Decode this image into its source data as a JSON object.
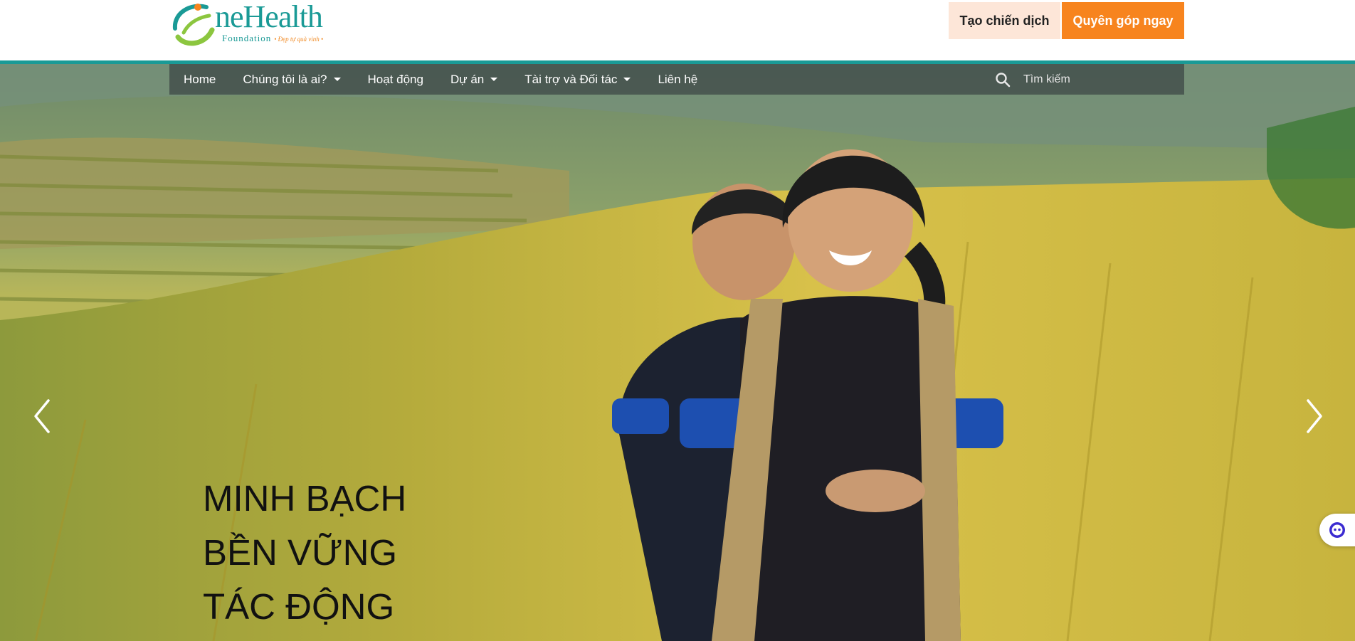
{
  "logo": {
    "name": "neHealth",
    "sub": "Foundation",
    "tagline": "• Đẹp tự quà vinh •"
  },
  "header": {
    "create_campaign": "Tạo chiến dịch",
    "donate_now": "Quyên góp ngay"
  },
  "nav": {
    "items": [
      {
        "label": "Home",
        "dropdown": false
      },
      {
        "label": "Chúng tôi là ai?",
        "dropdown": true
      },
      {
        "label": "Hoạt động",
        "dropdown": false
      },
      {
        "label": "Dự án",
        "dropdown": true
      },
      {
        "label": "Tài trợ và Đối tác",
        "dropdown": true
      },
      {
        "label": "Liên hệ",
        "dropdown": false
      }
    ],
    "search_placeholder": "Tìm kiếm"
  },
  "hero": {
    "slogan": [
      "MINH BẠCH",
      "BỀN VỮNG",
      "TÁC ĐỘNG"
    ]
  },
  "colors": {
    "brand_teal": "#1a9a96",
    "donate_orange": "#f7841e",
    "create_bg": "#fde6d8"
  }
}
